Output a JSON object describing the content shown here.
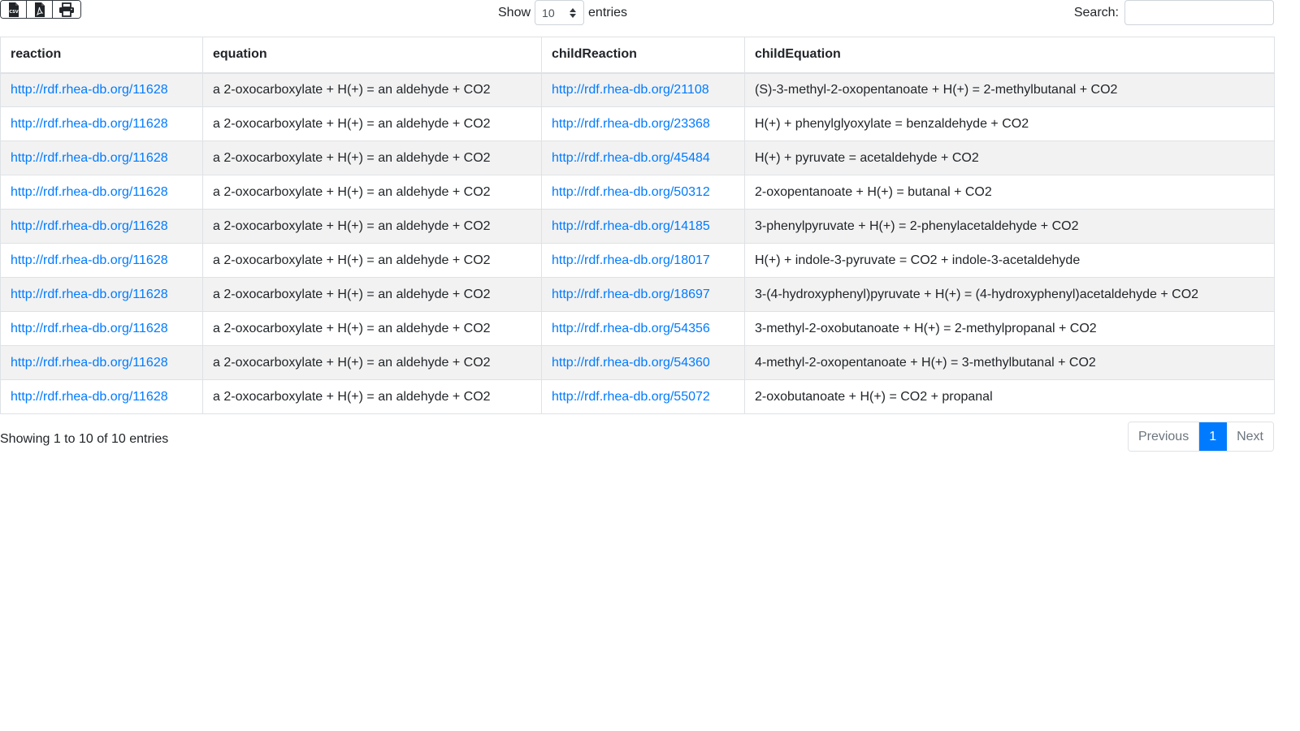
{
  "toolbar": {
    "buttons": [
      {
        "icon": "csv-file-icon",
        "label": "CSV"
      },
      {
        "icon": "pdf-file-icon"
      },
      {
        "icon": "print-icon"
      }
    ]
  },
  "length": {
    "prefix": "Show",
    "value": "10",
    "suffix": "entries"
  },
  "search": {
    "label": "Search:",
    "value": ""
  },
  "table": {
    "columns": [
      "reaction",
      "equation",
      "childReaction",
      "childEquation"
    ],
    "rows": [
      [
        "http://rdf.rhea-db.org/11628",
        "a 2-oxocarboxylate + H(+) = an aldehyde + CO2",
        "http://rdf.rhea-db.org/21108",
        "(S)-3-methyl-2-oxopentanoate + H(+) = 2-methylbutanal + CO2"
      ],
      [
        "http://rdf.rhea-db.org/11628",
        "a 2-oxocarboxylate + H(+) = an aldehyde + CO2",
        "http://rdf.rhea-db.org/23368",
        "H(+) + phenylglyoxylate = benzaldehyde + CO2"
      ],
      [
        "http://rdf.rhea-db.org/11628",
        "a 2-oxocarboxylate + H(+) = an aldehyde + CO2",
        "http://rdf.rhea-db.org/45484",
        "H(+) + pyruvate = acetaldehyde + CO2"
      ],
      [
        "http://rdf.rhea-db.org/11628",
        "a 2-oxocarboxylate + H(+) = an aldehyde + CO2",
        "http://rdf.rhea-db.org/50312",
        "2-oxopentanoate + H(+) = butanal + CO2"
      ],
      [
        "http://rdf.rhea-db.org/11628",
        "a 2-oxocarboxylate + H(+) = an aldehyde + CO2",
        "http://rdf.rhea-db.org/14185",
        "3-phenylpyruvate + H(+) = 2-phenylacetaldehyde + CO2"
      ],
      [
        "http://rdf.rhea-db.org/11628",
        "a 2-oxocarboxylate + H(+) = an aldehyde + CO2",
        "http://rdf.rhea-db.org/18017",
        "H(+) + indole-3-pyruvate = CO2 + indole-3-acetaldehyde"
      ],
      [
        "http://rdf.rhea-db.org/11628",
        "a 2-oxocarboxylate + H(+) = an aldehyde + CO2",
        "http://rdf.rhea-db.org/18697",
        "3-(4-hydroxyphenyl)pyruvate + H(+) = (4-hydroxyphenyl)acetaldehyde + CO2"
      ],
      [
        "http://rdf.rhea-db.org/11628",
        "a 2-oxocarboxylate + H(+) = an aldehyde + CO2",
        "http://rdf.rhea-db.org/54356",
        "3-methyl-2-oxobutanoate + H(+) = 2-methylpropanal + CO2"
      ],
      [
        "http://rdf.rhea-db.org/11628",
        "a 2-oxocarboxylate + H(+) = an aldehyde + CO2",
        "http://rdf.rhea-db.org/54360",
        "4-methyl-2-oxopentanoate + H(+) = 3-methylbutanal + CO2"
      ],
      [
        "http://rdf.rhea-db.org/11628",
        "a 2-oxocarboxylate + H(+) = an aldehyde + CO2",
        "http://rdf.rhea-db.org/55072",
        "2-oxobutanoate + H(+) = CO2 + propanal"
      ]
    ]
  },
  "footer": {
    "info": "Showing 1 to 10 of 10 entries",
    "previous": "Previous",
    "current_page": "1",
    "next": "Next"
  },
  "colors": {
    "link": "#007bff",
    "active_page": "#007bff",
    "stripe": "#f2f2f2"
  }
}
